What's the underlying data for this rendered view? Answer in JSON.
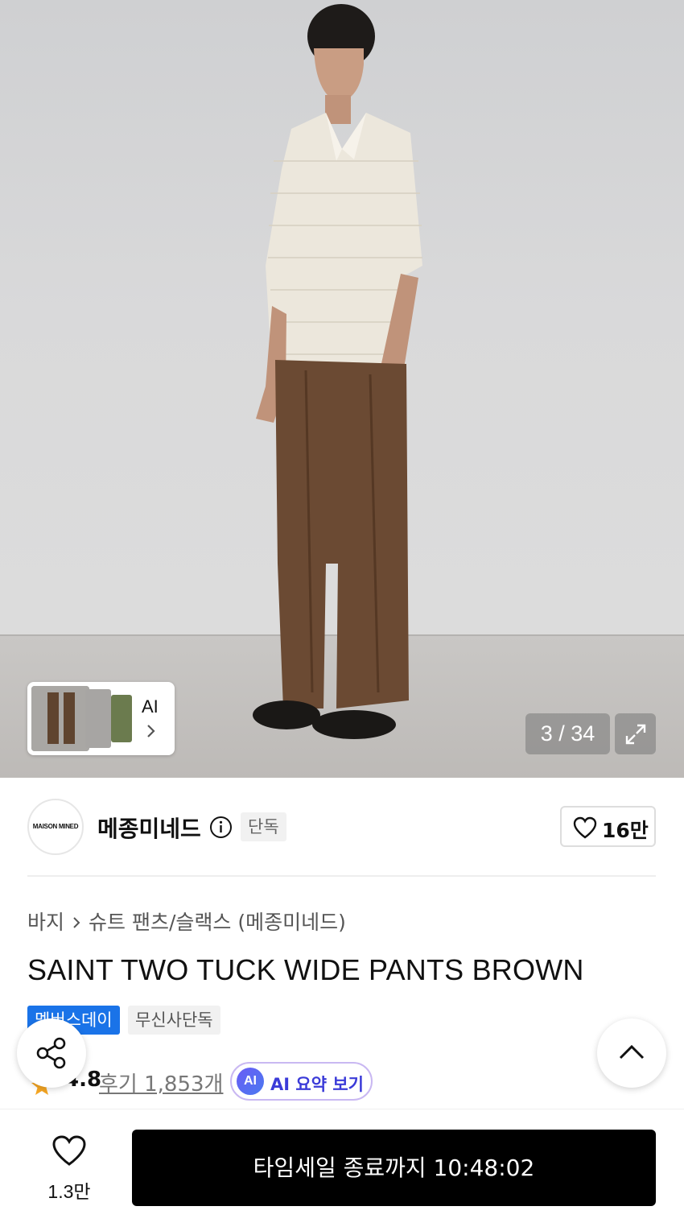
{
  "gallery": {
    "counter": "3 / 34",
    "ai_thumb_label": "AI"
  },
  "brand": {
    "logo_text": "MAISON MINED",
    "name": "메종미네드",
    "tag": "단독",
    "like_count": "16만"
  },
  "product": {
    "breadcrumb": {
      "level1": "바지",
      "level2": "슈트 팬츠/슬랙스 (메종미네드)"
    },
    "title": "SAINT TWO TUCK WIDE PANTS BROWN",
    "badges": [
      "멤버스데이",
      "무신사단독"
    ],
    "rating": "4.8",
    "reviews": "후기 1,853개",
    "ai_summary_badge": "AI",
    "ai_summary_label": "AI 요약 보기"
  },
  "bottom_bar": {
    "like_count": "1.3만",
    "buy_label": "타임세일 종료까지 10:48:02"
  },
  "colors": {
    "accent_blue": "#1a73e8",
    "ai_purple": "#6a5cf5",
    "buy_button": "#000000",
    "star": "#f5a623"
  }
}
